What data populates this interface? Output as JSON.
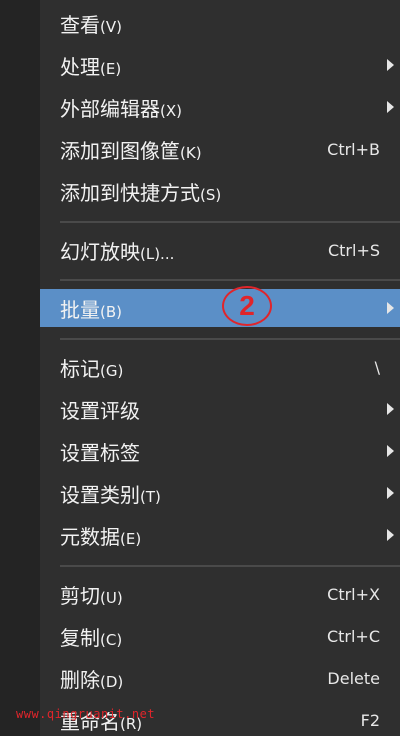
{
  "menu": {
    "items": [
      {
        "label": "查看",
        "mnemonic": "(V)",
        "shortcut": "",
        "submenu": false
      },
      {
        "label": "处理",
        "mnemonic": "(E)",
        "shortcut": "",
        "submenu": true
      },
      {
        "label": "外部编辑器",
        "mnemonic": "(X)",
        "shortcut": "",
        "submenu": true
      },
      {
        "label": "添加到图像筐",
        "mnemonic": "(K)",
        "shortcut": "Ctrl+B",
        "submenu": false
      },
      {
        "label": "添加到快捷方式",
        "mnemonic": "(S)",
        "shortcut": "",
        "submenu": false
      },
      {
        "label": "幻灯放映",
        "mnemonic": "(L)...",
        "shortcut": "Ctrl+S",
        "submenu": false
      },
      {
        "label": "批量",
        "mnemonic": "(B)",
        "shortcut": "",
        "submenu": true,
        "highlighted": true
      },
      {
        "label": "标记",
        "mnemonic": "(G)",
        "shortcut": "\\",
        "submenu": false
      },
      {
        "label": "设置评级",
        "mnemonic": "",
        "shortcut": "",
        "submenu": true
      },
      {
        "label": "设置标签",
        "mnemonic": "",
        "shortcut": "",
        "submenu": true
      },
      {
        "label": "设置类别",
        "mnemonic": "(T)",
        "shortcut": "",
        "submenu": true
      },
      {
        "label": "元数据",
        "mnemonic": "(E)",
        "shortcut": "",
        "submenu": true
      },
      {
        "label": "剪切",
        "mnemonic": "(U)",
        "shortcut": "Ctrl+X",
        "submenu": false
      },
      {
        "label": "复制",
        "mnemonic": "(C)",
        "shortcut": "Ctrl+C",
        "submenu": false
      },
      {
        "label": "删除",
        "mnemonic": "(D)",
        "shortcut": "Delete",
        "submenu": false
      },
      {
        "label": "重命名",
        "mnemonic": "(R)",
        "shortcut": "F2",
        "submenu": false
      }
    ]
  },
  "annotation": {
    "badge_text": "2",
    "color": "#e0252b"
  },
  "watermark": {
    "text": "www.qingruanit.net"
  },
  "colors": {
    "menu_background": "#2f2f2f",
    "highlight": "#5b8fc7",
    "text": "#f2f2f2"
  }
}
